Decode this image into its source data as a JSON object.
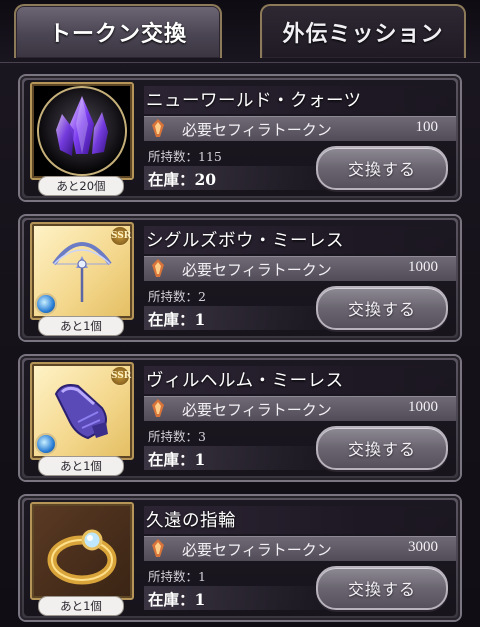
{
  "tabs": [
    {
      "label": "トークン交換",
      "active": true
    },
    {
      "label": "外伝ミッション",
      "active": false
    }
  ],
  "exchange_button_label": "交換する",
  "items": [
    {
      "name": "ニューワールド・クォーツ",
      "cost_label": "必要セフィラトークン",
      "cost": "100",
      "owned": "所持数：115",
      "stock": "在庫：20",
      "remaining": "あと20個",
      "icon": "crystal-orb-icon",
      "rarity": ""
    },
    {
      "name": "シグルズボウ・ミーレス",
      "cost_label": "必要セフィラトークン",
      "cost": "1000",
      "owned": "所持数：2",
      "stock": "在庫：1",
      "remaining": "あと1個",
      "icon": "bow-weapon-icon",
      "rarity": "SSR"
    },
    {
      "name": "ヴィルヘルム・ミーレス",
      "cost_label": "必要セフィラトークン",
      "cost": "1000",
      "owned": "所持数：3",
      "stock": "在庫：1",
      "remaining": "あと1個",
      "icon": "gauntlet-weapon-icon",
      "rarity": "SSR"
    },
    {
      "name": "久遠の指輪",
      "cost_label": "必要セフィラトークン",
      "cost": "3000",
      "owned": "所持数：1",
      "stock": "在庫：1",
      "remaining": "あと1個",
      "icon": "gold-ring-icon",
      "rarity": ""
    }
  ],
  "colors": {
    "frame_gold": "#b69558",
    "panel_dark": "#1c1822",
    "button_grey": "#6a6570"
  }
}
